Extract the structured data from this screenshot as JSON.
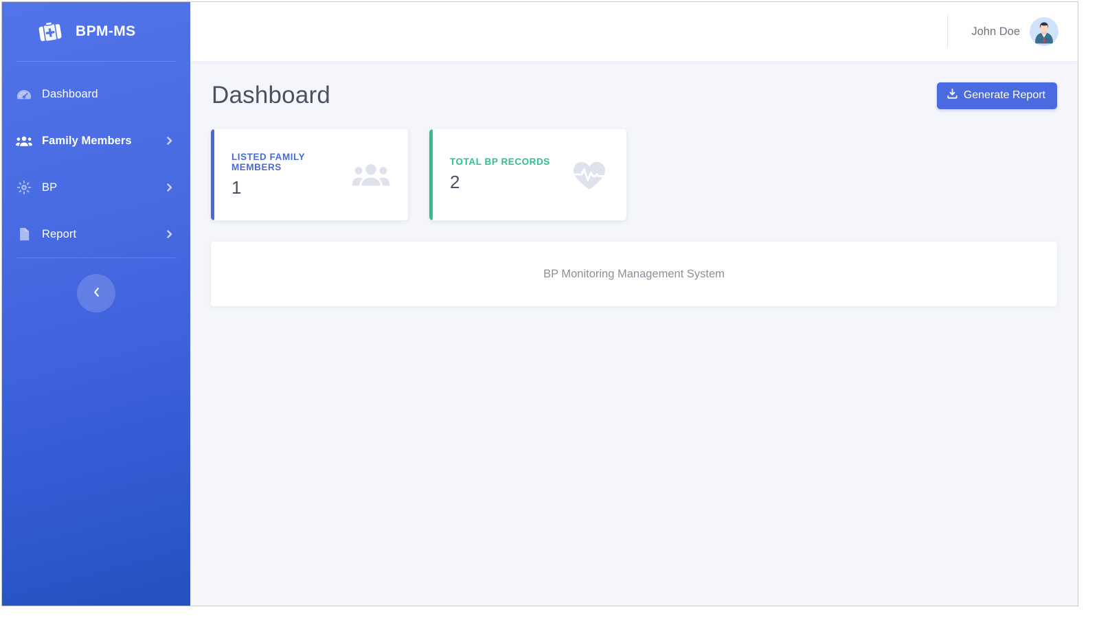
{
  "app": {
    "brand_title": "BPM-MS",
    "logo_icon": "medical-kit-icon"
  },
  "sidebar": {
    "items": [
      {
        "label": "Dashboard",
        "icon": "gauge-icon",
        "has_chevron": false
      },
      {
        "label": "Family Members",
        "icon": "users-icon",
        "has_chevron": true
      },
      {
        "label": "BP",
        "icon": "sun-icon",
        "has_chevron": true
      },
      {
        "label": "Report",
        "icon": "file-icon",
        "has_chevron": true
      }
    ],
    "collapse_icon": "chevron-left-icon"
  },
  "topbar": {
    "user_name": "John Doe",
    "avatar_icon": "user-avatar"
  },
  "main": {
    "page_title": "Dashboard",
    "generate_report_label": "Generate Report",
    "generate_report_icon": "download-icon",
    "stats": [
      {
        "label": "Listed Family Members",
        "value": "1",
        "accent": "#4a6ad4",
        "icon": "users-group-icon"
      },
      {
        "label": "Total BP Records",
        "value": "2",
        "accent": "#2ec08b",
        "icon": "heart-pulse-icon"
      }
    ],
    "info_text": "BP Monitoring Management System"
  },
  "colors": {
    "sidebar_top": "#5274e8",
    "sidebar_bottom": "#2451bd",
    "primary": "#4a6ae0",
    "content_bg": "#f4f6fb",
    "card_blue": "#4a6ad4",
    "card_green": "#2ec08b",
    "title_text": "#4b5161"
  }
}
